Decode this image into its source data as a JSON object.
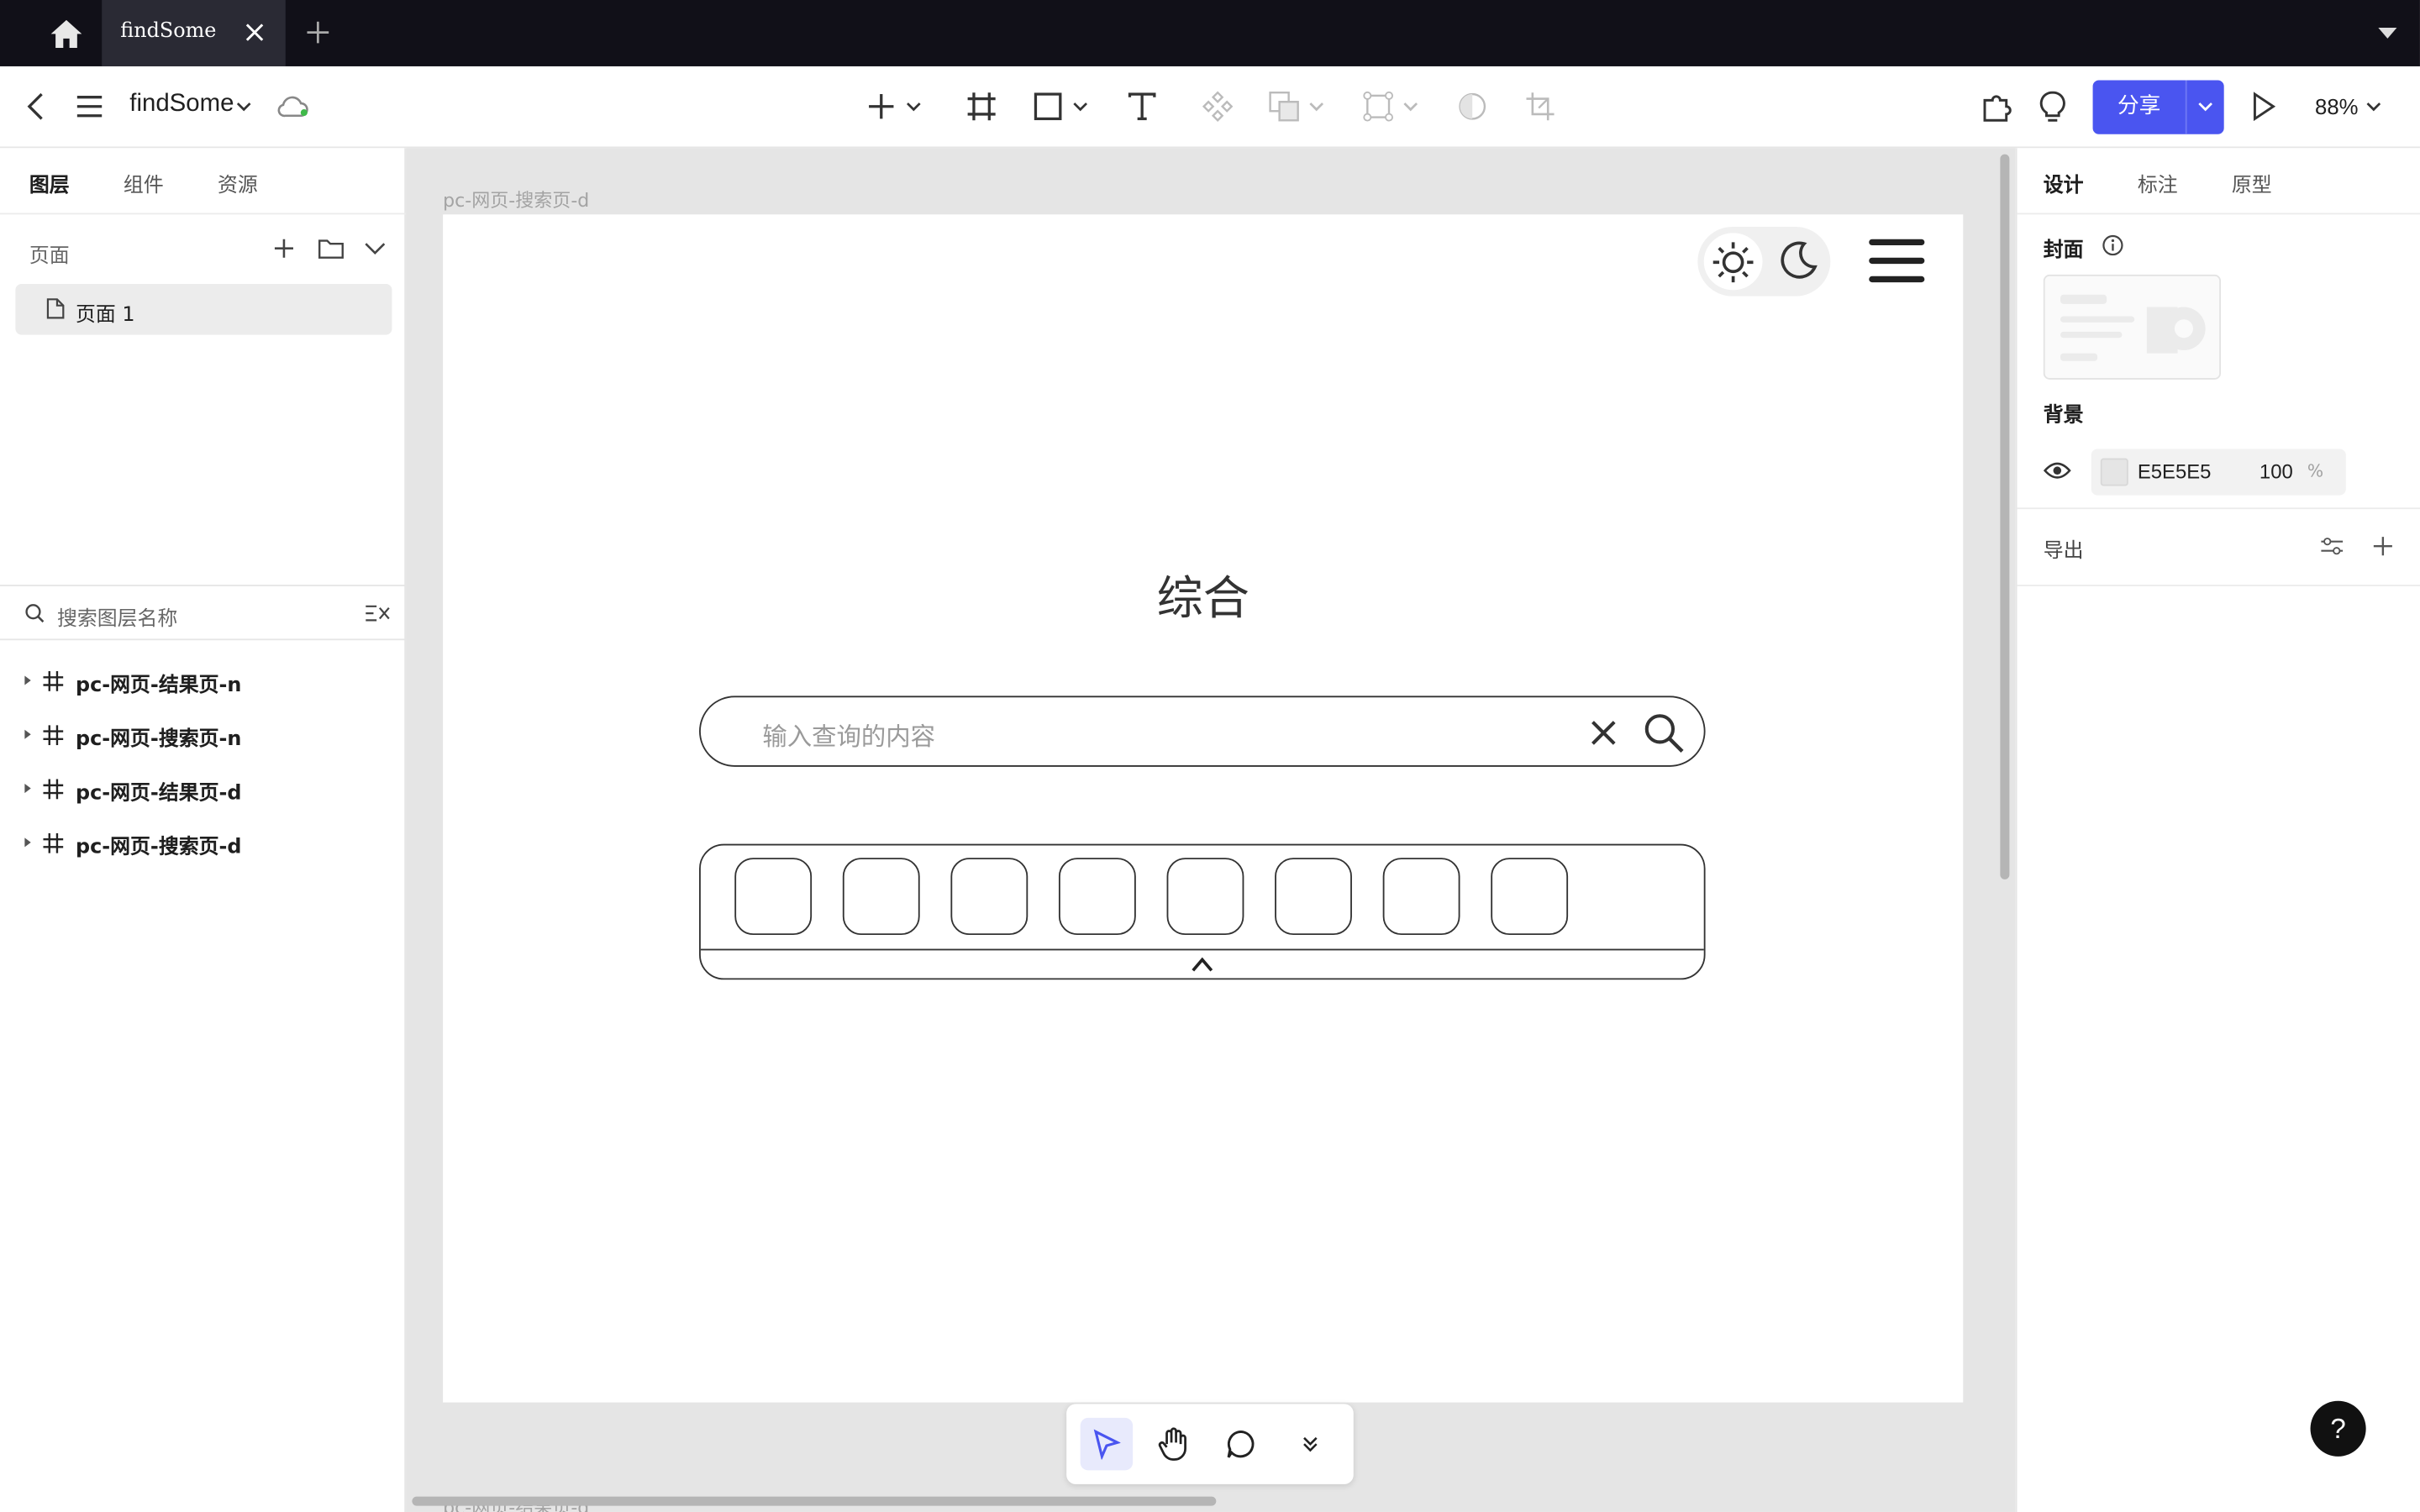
{
  "titlebar": {
    "tab_label": "findSome"
  },
  "toolbar": {
    "file_name": "findSome",
    "share_label": "分享",
    "zoom": "88%"
  },
  "left_panel": {
    "tabs": [
      {
        "label": "图层"
      },
      {
        "label": "组件"
      },
      {
        "label": "资源"
      }
    ],
    "pages_label": "页面",
    "pages": [
      {
        "label": "页面 1"
      }
    ],
    "search_placeholder": "搜索图层名称",
    "layers": [
      {
        "label": "pc-网页-结果页-n"
      },
      {
        "label": "pc-网页-搜索页-n"
      },
      {
        "label": "pc-网页-结果页-d"
      },
      {
        "label": "pc-网页-搜索页-d"
      }
    ]
  },
  "canvas": {
    "frame_title": "pc-网页-搜索页-d",
    "frame_title_below": "pc-网页-结果页-d",
    "heading": "综合",
    "search_placeholder": "输入查询的内容",
    "tray_slot_count": 8
  },
  "right_panel": {
    "tabs": [
      {
        "label": "设计"
      },
      {
        "label": "标注"
      },
      {
        "label": "原型"
      }
    ],
    "cover_label": "封面",
    "background_label": "背景",
    "background_hex": "E5E5E5",
    "background_opacity": "100",
    "opacity_unit": "%",
    "export_label": "导出",
    "help": "?"
  },
  "colors": {
    "accent": "#4a55f0",
    "titlebar": "#111018",
    "canvas": "#e5e5e5"
  }
}
